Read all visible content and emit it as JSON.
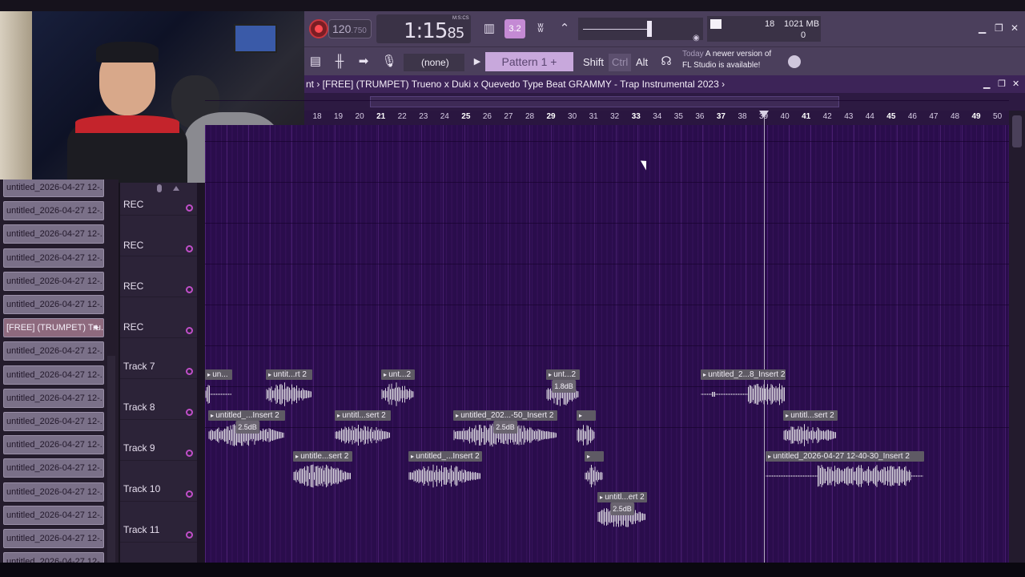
{
  "toolbar": {
    "tempo": "120",
    "tempo_decimal": ".750",
    "time": "1:15",
    "time_small": "85",
    "time_label": "M:S:CS",
    "pattern_mode_label": "3.2",
    "cpu_value": "18",
    "memory": "1021 MB",
    "polyphony": "0",
    "none_label": "(none)",
    "pattern_label": "Pattern 1",
    "add_label": "+",
    "shift_label": "Shift",
    "ctrl_label": "Ctrl",
    "alt_label": "Alt",
    "news_day": "Today",
    "news_line1": "A newer version of",
    "news_line2": "FL Studio is available!"
  },
  "playlist": {
    "title": "nt › [FREE] (TRUMPET) Trueno x Duki x Quevedo Type Beat GRAMMY - Trap Instrumental 2023 ›",
    "ruler": [
      "18",
      "19",
      "20",
      "21",
      "22",
      "23",
      "24",
      "25",
      "26",
      "27",
      "28",
      "29",
      "30",
      "31",
      "32",
      "33",
      "34",
      "35",
      "36",
      "37",
      "38",
      "39",
      "40",
      "41",
      "42",
      "43",
      "44",
      "45",
      "46",
      "47",
      "48",
      "49",
      "50"
    ],
    "ruler_bold": [
      "21",
      "25",
      "29",
      "33",
      "37",
      "41",
      "45",
      "49"
    ],
    "tracks": [
      {
        "label": "REC"
      },
      {
        "label": "REC"
      },
      {
        "label": "REC"
      },
      {
        "label": "REC"
      },
      {
        "label": "Track 7"
      },
      {
        "label": "Track 8"
      },
      {
        "label": "Track 9"
      },
      {
        "label": "Track 10"
      },
      {
        "label": "Track 11"
      }
    ]
  },
  "browser": {
    "items": [
      "untitled_2026-04-27 12-...",
      "untitled_2026-04-27 12-...",
      "untitled_2026-04-27 12-...",
      "untitled_2026-04-27 12-...",
      "untitled_2026-04-27 12-...",
      "untitled_2026-04-27 12-...",
      "[FREE] (TRUMPET) Tru...",
      "untitled_2026-04-27 12-...",
      "untitled_2026-04-27 12-...",
      "untitled_2026-04-27 12-...",
      "untitled_2026-04-27 12-...",
      "untitled_2026-04-27 12-...",
      "untitled_2026-04-27 12-...",
      "untitled_2026-04-27 12-...",
      "untitled_2026-04-27 12-...",
      "untitled_2026-04-27 12-...",
      "untitled_2026-04-27 12-..."
    ],
    "selected_index": 6
  },
  "clips": [
    {
      "label": "un..."
    },
    {
      "label": "untit...rt 2"
    },
    {
      "label": "unt...2"
    },
    {
      "label": "unt...2",
      "gain": "1.8dB"
    },
    {
      "label": "untitled_2...8_Insert 2"
    },
    {
      "label": "untitled_...Insert 2",
      "gain": "2.5dB"
    },
    {
      "label": "untitl...sert 2"
    },
    {
      "label": "untitled_202...-50_Insert 2",
      "gain": "2.5dB"
    },
    {
      "label": ""
    },
    {
      "label": "untitl...sert 2"
    },
    {
      "label": "untitle...sert 2"
    },
    {
      "label": "untitled_...Insert 2"
    },
    {
      "label": ""
    },
    {
      "label": "untitled_2026-04-27 12-40-30_Insert 2"
    },
    {
      "label": "untitl...ert 2",
      "gain": "2.5dB"
    }
  ],
  "colors": {
    "grid_bg": "#2a0d4c",
    "toolbar_bg": "#4b3f5c",
    "accent": "#c04ec8",
    "record": "#ff4a52"
  }
}
